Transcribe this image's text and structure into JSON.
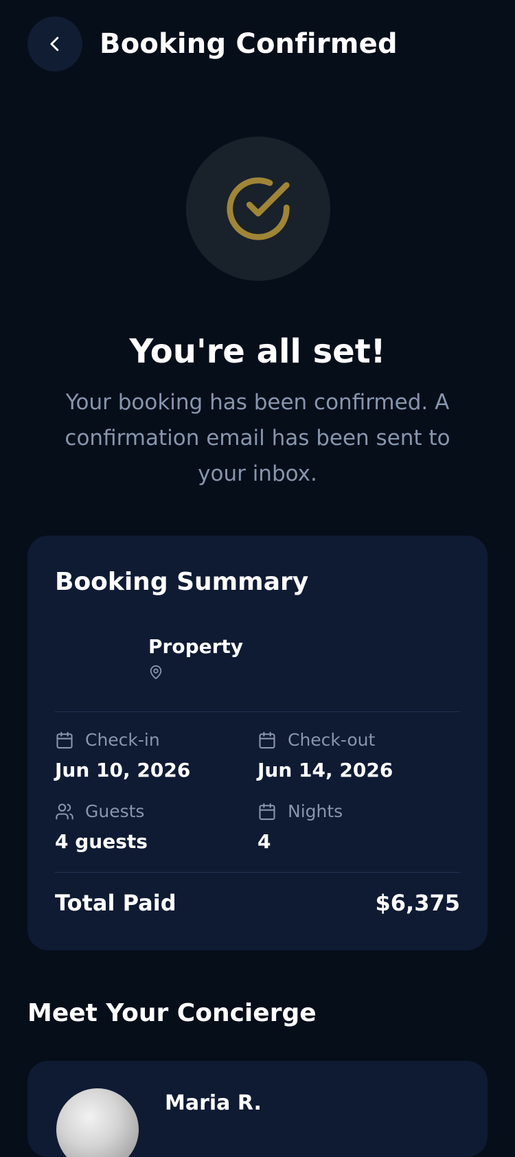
{
  "header": {
    "title": "Booking Confirmed",
    "back_icon": "chevron-left-icon"
  },
  "hero": {
    "icon": "check-circle-icon",
    "title": "You're all set!",
    "subtitle": "Your booking has been confirmed. A confirmation email has been sent to your inbox."
  },
  "summary": {
    "title": "Booking Summary",
    "property": {
      "name": "Property",
      "icon": "map-pin-icon"
    },
    "checkin": {
      "label": "Check-in",
      "value": "Jun 10, 2026",
      "icon": "calendar-icon"
    },
    "checkout": {
      "label": "Check-out",
      "value": "Jun 14, 2026",
      "icon": "calendar-icon"
    },
    "guests": {
      "label": "Guests",
      "value": "4 guests",
      "icon": "users-icon"
    },
    "nights": {
      "label": "Nights",
      "value": "4",
      "icon": "calendar-icon"
    },
    "total": {
      "label": "Total Paid",
      "value": "$6,375"
    }
  },
  "concierge": {
    "title": "Meet Your Concierge",
    "name": "Maria R."
  },
  "colors": {
    "background": "#060e1a",
    "card": "#0f1b33",
    "accent_gold": "#a08537",
    "muted_text": "#8796ae"
  }
}
